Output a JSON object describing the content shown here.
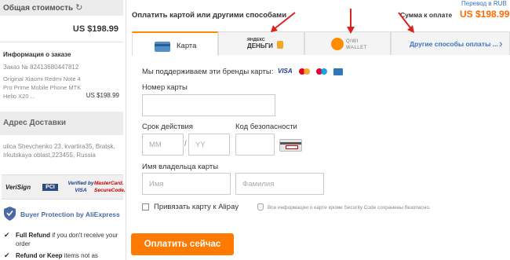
{
  "summary": {
    "total_label": "Общая стоимость",
    "refresh_icon": "refresh-icon",
    "total_value": "US $198.99"
  },
  "order": {
    "heading": "Информация о заказе",
    "number": "Заказ № 82413680447812",
    "title": "Original Xiaomi Redmi Note 4 Pro Prime Mobile Phone MTK Helio X20 ...",
    "price": "US $198.99"
  },
  "address": {
    "heading": "Адрес Доставки",
    "text": "ulica Shevchenko 23, kvartira35, Bratsk, Irkutskaya oblast,223455, Russia"
  },
  "badges": {
    "verisign": "VeriSign",
    "pci": "PCI",
    "visa": "Verified by VISA",
    "mastercard": "MasterCard. SecureCode."
  },
  "protection": {
    "title": "Buyer Protection by AliExpress",
    "feature1_bold": "Full Refund",
    "feature1_rest": " if you don't receive your order",
    "feature2_bold": "Refund or Keep",
    "feature2_rest": " items not as"
  },
  "header": {
    "heading": "Оплатить картой или другими способами",
    "currency_link": "Перевод в RUB",
    "sum_label": "Сумма к оплате",
    "sum_value": "US $198.99"
  },
  "tabs": {
    "card": "Карта",
    "yandex_small": "ЯНДЕКС",
    "yandex_big": "ДЕНЬГИ",
    "qiwi": "QIWI\nWALLET",
    "other": "Другие способы оплаты ..."
  },
  "form": {
    "brands_label": "Мы поддерживаем эти бренды карты:",
    "brand_visa": "VISA",
    "card_number_label": "Номер карты",
    "expiry_label": "Срок действия",
    "mm_placeholder": "MM",
    "slash": "/",
    "yy_placeholder": "YY",
    "cvv_label": "Код безопасности",
    "holder_label": "Имя владельца карты",
    "first_name_placeholder": "Имя",
    "last_name_placeholder": "Фамилия",
    "bind_label": "Привязать карту к Alipay",
    "info_text": "Все информации о карте кроме Security Code сохранены безопасно.",
    "pay_button": "Оплатить сейчас"
  },
  "colors": {
    "accent_orange": "#ff7a00",
    "link_blue": "#3a73c2",
    "arrow_red": "#d9231f"
  }
}
